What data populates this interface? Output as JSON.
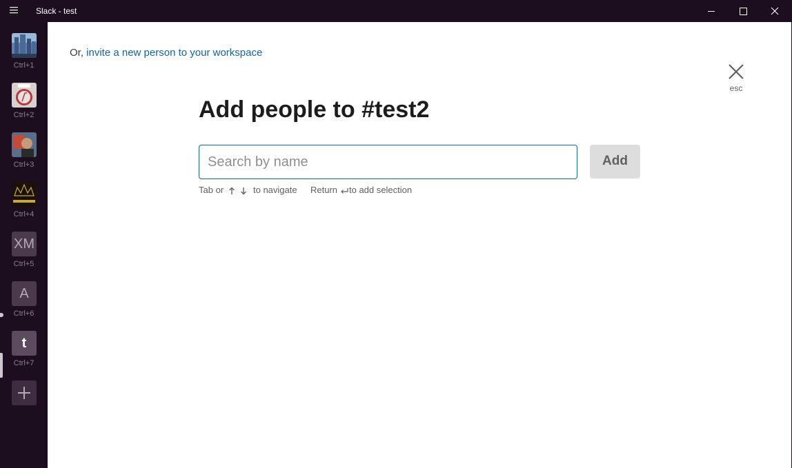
{
  "window": {
    "title": "Slack - test",
    "menu_icon": "hamburger-icon",
    "controls": [
      "minimize-icon",
      "maximize-icon",
      "close-icon"
    ]
  },
  "sidebar": {
    "workspaces": [
      {
        "shortcut": "Ctrl+1",
        "icon": "city-photo",
        "letter": ""
      },
      {
        "shortcut": "Ctrl+2",
        "icon": "rtmp-logo",
        "letter": ""
      },
      {
        "shortcut": "Ctrl+3",
        "icon": "person-photo",
        "letter": ""
      },
      {
        "shortcut": "Ctrl+4",
        "icon": "gold-city-logo",
        "letter": ""
      },
      {
        "shortcut": "Ctrl+5",
        "icon": "letter",
        "letter": "XM"
      },
      {
        "shortcut": "Ctrl+6",
        "icon": "letter",
        "letter": "A"
      },
      {
        "shortcut": "Ctrl+7",
        "icon": "letter",
        "letter": "t"
      }
    ],
    "add_workspace_icon": "plus-icon"
  },
  "dialog": {
    "invite_prefix": "Or, ",
    "invite_link": "invite a new person to your workspace",
    "close_label": "esc",
    "title": "Add people to #test2",
    "search_placeholder": "Search by name",
    "add_button": "Add",
    "hint_tab": "Tab or",
    "hint_navigate": "to navigate",
    "hint_return": "Return",
    "hint_add": "to add selection"
  },
  "colors": {
    "sidebar": "#1d0e1f",
    "link": "#1264a3",
    "focus_border": "#1264a3",
    "add_button_bg": "#dddddd"
  }
}
